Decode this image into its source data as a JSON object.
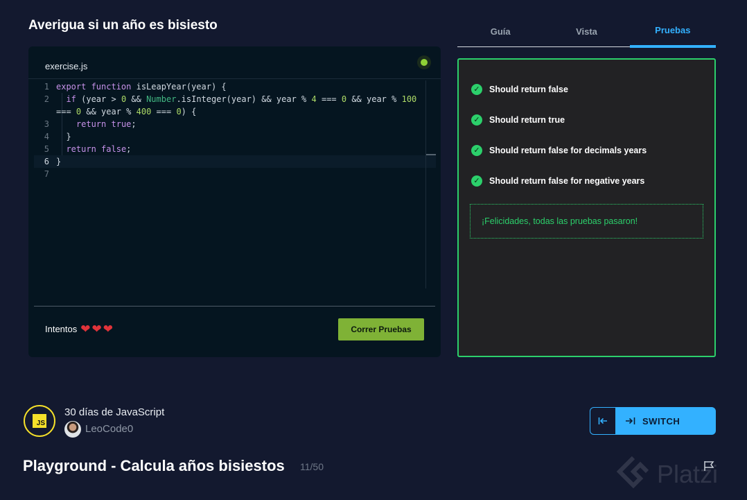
{
  "page": {
    "exercise_title": "Averigua si un año es bisiesto"
  },
  "editor": {
    "filename": "exercise.js",
    "lines": [
      {
        "n": "1",
        "html": "<span class=\"kw\">export function</span> isLeapYear(year) {"
      },
      {
        "n": "2",
        "html": "  <span class=\"kw\">if</span> (year &gt; <span class=\"num\">0</span> &amp;&amp; <span class=\"cls\">Number</span>.isInteger(year) &amp;&amp; year % <span class=\"num\">4</span> === <span class=\"num\">0</span> &amp;&amp; year % <span class=\"num\">100</span>"
      },
      {
        "n": "",
        "html": "=== <span class=\"num\">0</span> &amp;&amp; year % <span class=\"num\">400</span> === <span class=\"num\">0</span>) {"
      },
      {
        "n": "3",
        "html": "    <span class=\"kw\">return</span> <span class=\"kw\">true</span>;"
      },
      {
        "n": "4",
        "html": "  }"
      },
      {
        "n": "5",
        "html": "  <span class=\"kw\">return</span> <span class=\"kw\">false</span>;"
      },
      {
        "n": "6",
        "html": "}",
        "active": true
      },
      {
        "n": "7",
        "html": ""
      }
    ],
    "attempts_label": "Intentos",
    "hearts": [
      "❤",
      "❤",
      "❤"
    ],
    "run_button_label": "Correr Pruebas"
  },
  "tabs": [
    {
      "label": "Guía",
      "active": false
    },
    {
      "label": "Vista",
      "active": false
    },
    {
      "label": "Pruebas",
      "active": true
    }
  ],
  "tests": {
    "items": [
      "Should return false",
      "Should return true",
      "Should return false for decimals years",
      "Should return false for negative years"
    ],
    "success_message": "¡Felicidades, todas las pruebas pasaron!"
  },
  "course": {
    "logo_text": "JS",
    "name": "30 días de JavaScript",
    "author": "LeoCode0"
  },
  "switch": {
    "label": "SWITCH"
  },
  "lesson": {
    "title": "Playground - Calcula años bisiestos",
    "progress": "11/50"
  },
  "watermark": {
    "text": "Platzi"
  },
  "colors": {
    "background": "#13192f",
    "accent": "#33b1ff",
    "success": "#2cd06b",
    "run_button": "#7fb236"
  }
}
